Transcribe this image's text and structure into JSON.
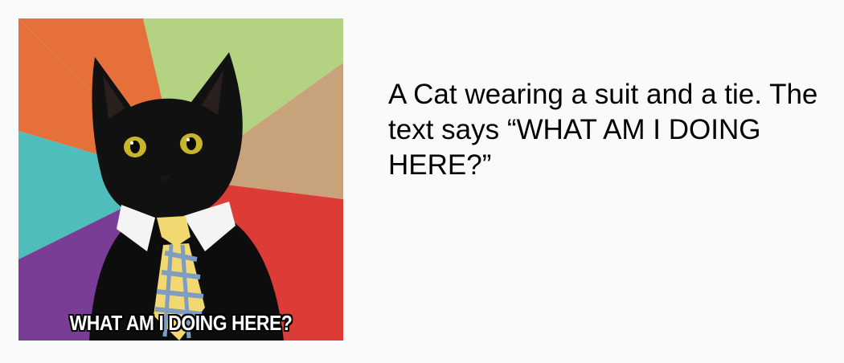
{
  "meme": {
    "caption": "WHAT AM I DOING HERE?"
  },
  "description": {
    "text": "A Cat wearing a suit and a tie. The text says “WHAT AM I DOING HERE?”"
  },
  "colors": {
    "background": "#fafafa",
    "ray_orange": "#e5703a",
    "ray_green": "#b3d382",
    "ray_tan": "#c8a27a",
    "ray_teal": "#4fbdbb",
    "ray_red": "#dc3b36",
    "ray_purple": "#7a3d96",
    "tie_yellow": "#f2d870",
    "tie_blue": "#7f9cc2"
  }
}
